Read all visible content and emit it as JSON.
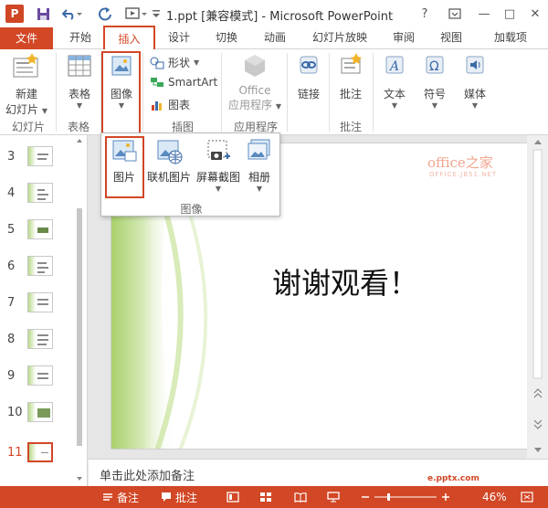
{
  "window": {
    "app_icon": "P",
    "title": "1.ppt [兼容模式] - Microsoft PowerPoint",
    "controls": [
      "?",
      "—",
      "□",
      "✕"
    ]
  },
  "tabs": [
    {
      "label": "文件"
    },
    {
      "label": "开始"
    },
    {
      "label": "插入"
    },
    {
      "label": "设计"
    },
    {
      "label": "切换"
    },
    {
      "label": "动画"
    },
    {
      "label": "幻灯片放映"
    },
    {
      "label": "审阅"
    },
    {
      "label": "视图"
    },
    {
      "label": "加载项"
    }
  ],
  "ribbon": {
    "new_slide": {
      "line1": "新建",
      "line2": "幻灯片"
    },
    "table": "表格",
    "image": "图像",
    "shapes": "形状",
    "smartart": "SmartArt",
    "chart": "图表",
    "office_apps": {
      "line1": "Office",
      "line2": "应用程序"
    },
    "link": "链接",
    "comment": "批注",
    "text": "文本",
    "symbol": "符号",
    "media": "媒体",
    "groups": {
      "slides": "幻灯片",
      "tables": "表格",
      "illustrations": "插图",
      "apps": "应用程序",
      "comments": "批注"
    }
  },
  "dropdown": {
    "items": [
      "图片",
      "联机图片",
      "屏幕截图",
      "相册"
    ],
    "group_label": "图像"
  },
  "slides": {
    "numbers": [
      "3",
      "4",
      "5",
      "6",
      "7",
      "8",
      "9",
      "10",
      "11"
    ],
    "active": "11"
  },
  "slide": {
    "title": "谢谢观看！",
    "watermark_brand": "office之家",
    "watermark_url": "OFFICE.JB51.NET"
  },
  "notes": {
    "placeholder": "单击此处添加备注"
  },
  "status": {
    "notes_btn": "备注",
    "comments_btn": "批注",
    "zoom": "46%",
    "site_watermark": "e.pptx.com"
  },
  "colors": {
    "accent": "#d24726",
    "ribbon_bg": "#ffffff",
    "canvas_bg": "#e6e6e6"
  }
}
